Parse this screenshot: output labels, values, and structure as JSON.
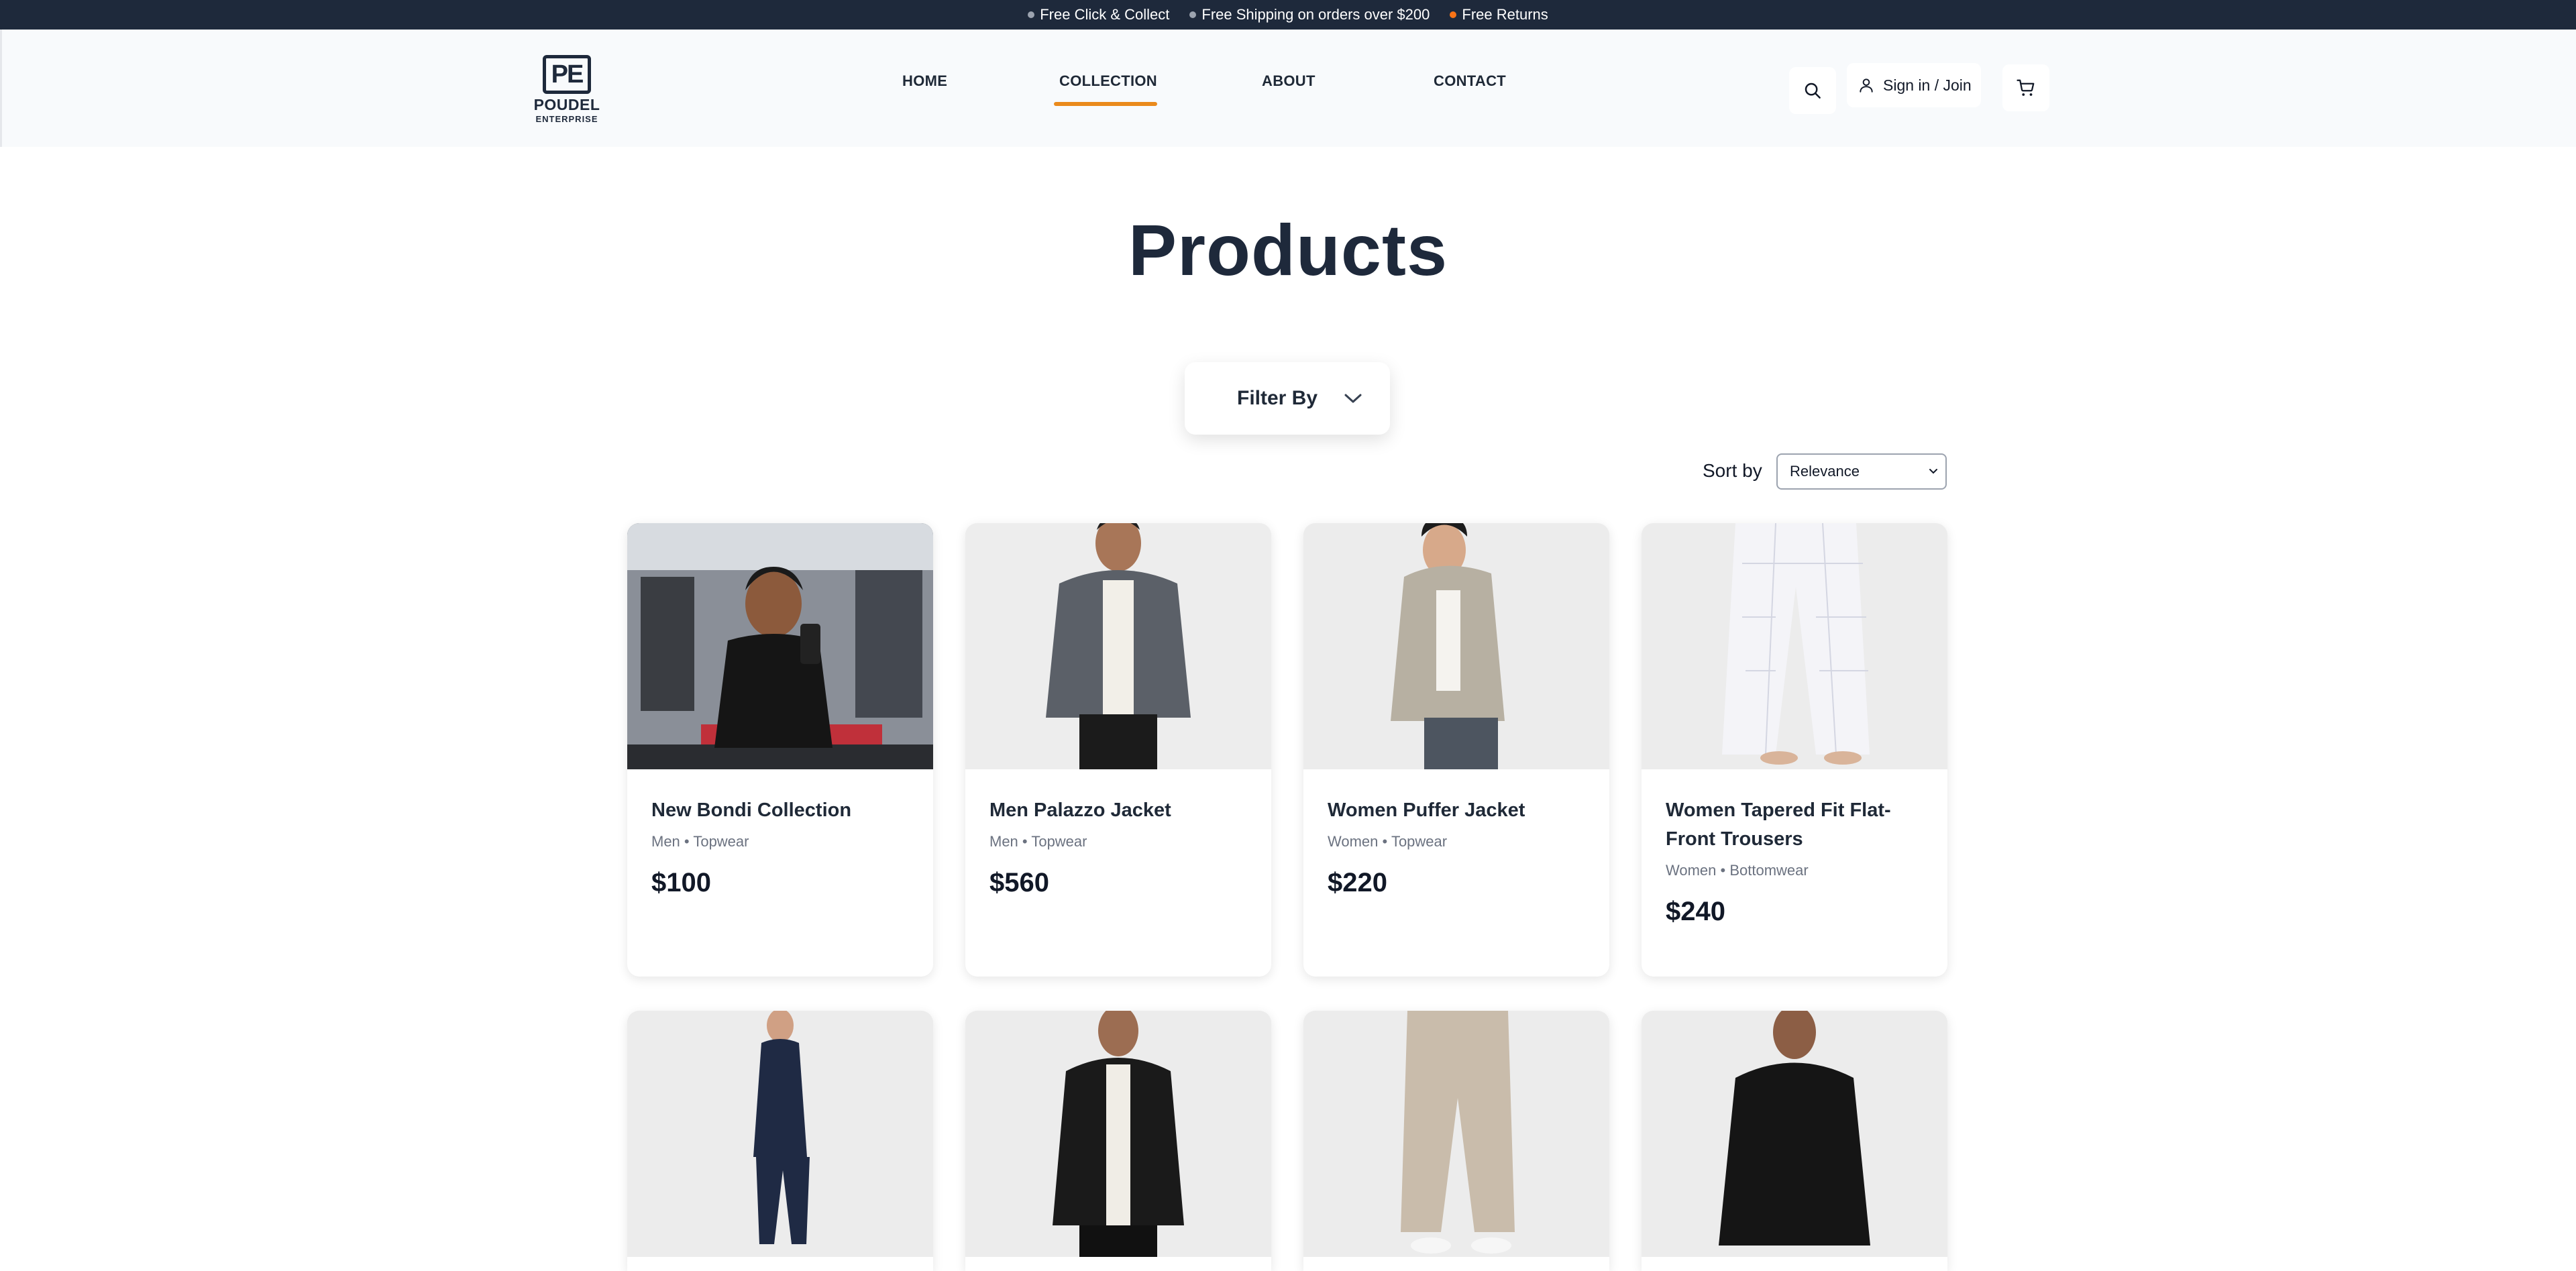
{
  "announcement": {
    "items": [
      {
        "text": "Free Click & Collect",
        "dot_color": "#9ca3af"
      },
      {
        "text": "Free Shipping on orders over $200",
        "dot_color": "#9ca3af"
      },
      {
        "text": "Free Returns",
        "dot_color": "#f97316"
      }
    ]
  },
  "brand": {
    "mark": "PE",
    "name": "POUDEL",
    "sub": "ENTERPRISE"
  },
  "nav": {
    "items": [
      {
        "label": "HOME"
      },
      {
        "label": "COLLECTION",
        "active": true
      },
      {
        "label": "ABOUT"
      },
      {
        "label": "CONTACT"
      }
    ]
  },
  "header_actions": {
    "search_icon": "search-icon",
    "signin_label": "Sign in / Join",
    "user_icon": "user-icon",
    "cart_icon": "cart-icon"
  },
  "page": {
    "title": "Products"
  },
  "filter": {
    "label": "Filter By",
    "icon": "chevron-down-icon"
  },
  "sort": {
    "label": "Sort by",
    "selected": "Relevance"
  },
  "products": [
    {
      "name": "New Bondi Collection",
      "gender": "Men",
      "category": "Topwear",
      "price": "$100",
      "image": "gym-selfie-man-black-tank"
    },
    {
      "name": "Men Palazzo Jacket",
      "gender": "Men",
      "category": "Topwear",
      "price": "$560",
      "image": "man-grey-jacket"
    },
    {
      "name": "Women Puffer Jacket",
      "gender": "Women",
      "category": "Topwear",
      "price": "$220",
      "image": "woman-beige-puffer"
    },
    {
      "name": "Women Tapered Fit Flat-Front Trousers",
      "gender": "Women",
      "category": "Bottomwear",
      "price": "$240",
      "image": "white-plaid-trousers"
    },
    {
      "name": "",
      "gender": "",
      "category": "",
      "price": "",
      "image": "woman-navy-pajama-set"
    },
    {
      "name": "",
      "gender": "",
      "category": "",
      "price": "",
      "image": "man-black-bomber"
    },
    {
      "name": "",
      "gender": "",
      "category": "",
      "price": "",
      "image": "beige-joggers"
    },
    {
      "name": "",
      "gender": "",
      "category": "",
      "price": "",
      "image": "man-black-zip-sweater"
    }
  ],
  "colors": {
    "topbar": "#1e293b",
    "accent": "#ea8a1c",
    "text": "#1f2937",
    "header_bg": "#f8fafc"
  }
}
